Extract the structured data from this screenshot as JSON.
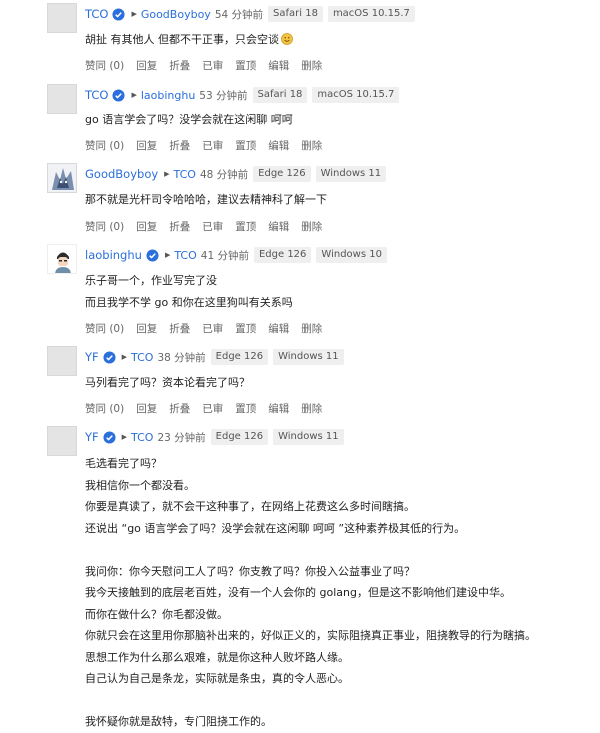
{
  "colors": {
    "link": "#2a6fdb",
    "verified": "#2a6fdb"
  },
  "actions_labels": [
    "赞同 (0)",
    "回复",
    "折叠",
    "已审",
    "置顶",
    "编辑",
    "删除"
  ],
  "comments": [
    {
      "author": "TCO",
      "reply_to": "GoodBoyboy",
      "time": "54 分钟前",
      "browser": "Safari 18",
      "os": "macOS 10.15.7",
      "lines": [
        "胡扯 有其他人 但都不干正事，只会空谈"
      ],
      "emoji": "smiling-face-icon"
    },
    {
      "author": "TCO",
      "reply_to": "laobinghu",
      "time": "53 分钟前",
      "browser": "Safari 18",
      "os": "macOS 10.15.7",
      "lines": [
        "go 语言学会了吗？没学会就在这闲聊 呵呵"
      ]
    },
    {
      "author": "GoodBoyboy",
      "reply_to": "TCO",
      "time": "48 分钟前",
      "browser": "Edge 126",
      "os": "Windows 11",
      "lines": [
        "那不就是光杆司令哈哈哈，建议去精神科了解一下"
      ]
    },
    {
      "author": "laobinghu",
      "reply_to": "TCO",
      "time": "41 分钟前",
      "browser": "Edge 126",
      "os": "Windows 10",
      "lines": [
        "乐子哥一个，作业写完了没",
        "而且我学不学 go 和你在这里狗叫有关系吗"
      ]
    },
    {
      "author": "YF",
      "reply_to": "TCO",
      "time": "38 分钟前",
      "browser": "Edge 126",
      "os": "Windows 11",
      "lines": [
        "马列看完了吗？资本论看完了吗？"
      ]
    },
    {
      "author": "YF",
      "reply_to": "TCO",
      "time": "23 分钟前",
      "browser": "Edge 126",
      "os": "Windows 11",
      "lines": [
        "毛选看完了吗？",
        "我相信你一个都没看。",
        "你要是真读了，就不会干这种事了，在网络上花费这么多时间瞎搞。",
        "还说出 “go 语言学会了吗？没学会就在这闲聊 呵呵 ”这种素养极其低的行为。",
        "",
        "我问你：你今天慰问工人了吗？你支教了吗？你投入公益事业了吗？",
        "我今天接触到的底层老百姓，没有一个人会你的 golang，但是这不影响他们建设中华。",
        "而你在做什么？你毛都没做。",
        "你就只会在这里用你那脑补出来的，好似正义的，实际阻挠真正事业，阻挠教导的行为瞎搞。",
        "思想工作为什么那么艰难，就是你这种人败坏路人缘。",
        "自己认为自己是条龙，实际就是条虫，真的令人恶心。",
        "",
        "我怀疑你就是敌特，专门阻挠工作的。"
      ]
    }
  ]
}
